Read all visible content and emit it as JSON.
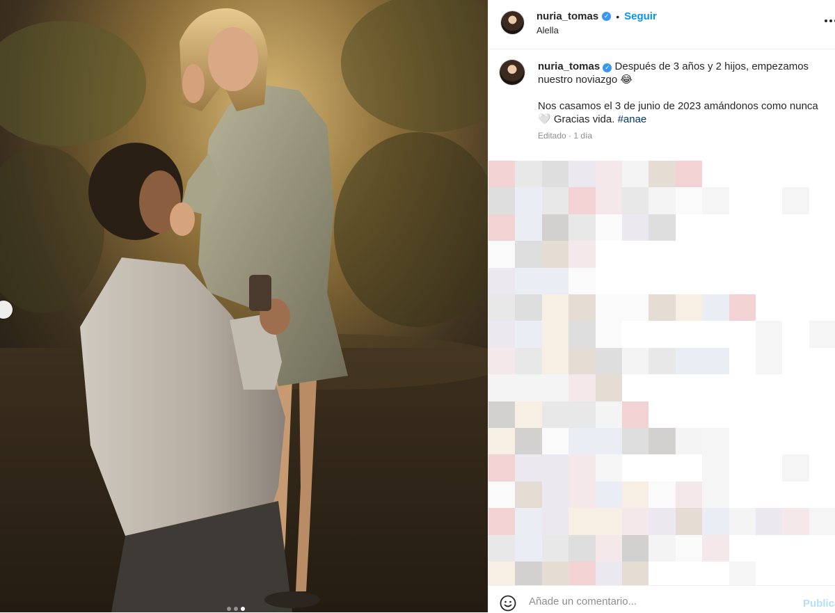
{
  "post": {
    "username": "nuria_tomas",
    "verified_badge": "✓",
    "separator": "•",
    "follow_label": "Seguir",
    "location": "Alella",
    "more_icon": "ellipsis-icon"
  },
  "caption": {
    "username": "nuria_tomas",
    "line1": "Después de 3 años y 2 hijos, empezamos nuestro noviazgo 😂",
    "line2": "Nos casamos el 3 de junio de 2023 amándonos como nunca 🤍 Gracias vida.",
    "hashtag": "#anae",
    "edited": "Editado",
    "meta_sep": "·",
    "time": "1 día"
  },
  "carousel": {
    "prev_icon": "chevron-left-icon",
    "slides": 3,
    "active_slide": 3
  },
  "comment_box": {
    "emoji_icon": "smiley-icon",
    "placeholder": "Añade un comentario...",
    "publish_label": "Publicar"
  },
  "colors": {
    "link_blue": "#0095f6",
    "verified_blue": "#3897f0",
    "hashtag": "#00376b",
    "muted": "#8e8e8e",
    "publish_disabled": "#b2dffc"
  }
}
